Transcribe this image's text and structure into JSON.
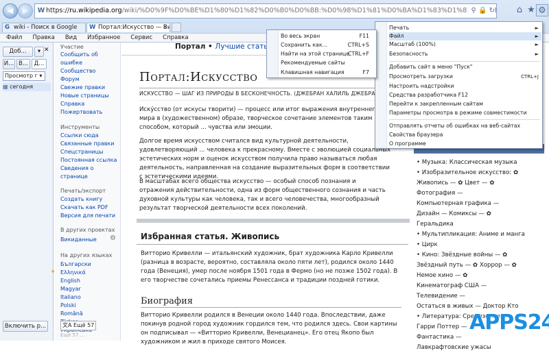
{
  "browser": {
    "address_prefix": "https://",
    "address_host": "ru.wikipedia.org",
    "address_path": "/wiki/%D0%9F%D0%BE%D1%80%D1%82%D0%B0%D0%BB:%D0%98%D1%81%D0%BA%D1%83%D1%81%D1%81%D1%82%D0%B2%D0%BE",
    "tabs": [
      {
        "label": "wiki - Поиск в Google",
        "icon": "G"
      },
      {
        "label": "Портал:Искусство — Вики...",
        "icon": "W"
      }
    ],
    "menu": [
      "Файл",
      "Правка",
      "Вид",
      "Избранное",
      "Сервис",
      "Справка"
    ]
  },
  "left_toolbar": {
    "btn1": "Доб...",
    "btn2": "И...",
    "btn3": "В...",
    "btn4": "Д...",
    "view_select": "Просмотр г",
    "today": "сегодня",
    "enable_button": "Включить р..."
  },
  "sidebar": {
    "participation_title": "Участие",
    "participation": [
      "Сообщить об ошибке",
      "Сообщество",
      "Форум",
      "Свежие правки",
      "Новые страницы",
      "Справка",
      "Пожертвовать"
    ],
    "tools_title": "Инструменты",
    "tools": [
      "Ссылки сюда",
      "Связанные правки",
      "Спецстраницы",
      "Постоянная ссылка",
      "Сведения о странице"
    ],
    "print_title": "Печать/экспорт",
    "print": [
      "Создать книгу",
      "Скачать как PDF",
      "Версия для печати"
    ],
    "projects_title": "В других проектах",
    "projects": [
      "Викиданные"
    ],
    "langs_title": "На других языках",
    "langs": [
      "Български",
      "Ελληνικά",
      "English",
      "Magyar",
      "Italiano",
      "Polski",
      "Română",
      "Türkçe",
      "Українська"
    ],
    "more_langs": "Ещё 57",
    "more_langs_sub": "Ещё 57 ..."
  },
  "page": {
    "breadcrumb_portal": "Портал",
    "breadcrumb_sep": " • ",
    "breadcrumb_link": "Лучшие статьи",
    "title": "Портал:Искусство",
    "motto": "ИСКУССТВО — ШАГ ИЗ ПРИРОДЫ В БЕСКОНЕЧНОСТЬ. (ДЖЕБРАН ХАЛИЛЬ ДЖЕБРАН)",
    "p1": "Иску́сство (от искусы творити) — процесс или итог выражения внутреннего мира в (художественном) образе, творческое сочетание элементов таким способом, который ... чувства или эмоции.",
    "p2": "Долгое время искусством считался вид культурной деятельности, удовлетворяющий ... человека к прекрасному. Вместе с эволюцией социальных эстетических норм и оценок искусством получила право называться любая деятельность, направленная на создание выразительных форм в соответствии с эстетическими идеями.",
    "p3": "В масштабах всего общества искусство — особый способ познания и отражения действительности, одна из форм общественного сознания и часть духовной культуры как человека, так и всего человечества, многообразный результат творческой деятельности всех поколений.",
    "featured_title": "Избранная статья. Живопись",
    "featured_text": "Витторио Кривелли — итальянский художник, брат художника Карло Кривелли (разница в возрасте, вероятно, составляла около пяти лет), родился около 1440 года (Венеция), умер после ноября 1501 года в Фермо (но не позже 1502 года). В его творчестве сочетались приемы Ренессанса и традиции поздней готики.",
    "bio_title": "Биография",
    "bio_text": "Витторио Кривелли родился в Венеции около 1440 года. Впоследствии, даже покинув родной город художник гордился тем, что родился здесь. Свои картины он подписывал — «Витторио Кривелли, Венецианец». Его отец Якопо был художником и жил в приходе святого Моисея."
  },
  "right_list": [
    "• Музыка: Классическая музыка",
    "• Изобразительное искусство: ✿",
    "   Живопись — ✿ Цвет — ✿",
    "   Фотография —",
    "   Компьютерная графика —",
    "   Дизайн — Комиксы — ✿",
    "   Геральдика",
    "• Мультипликация: Аниме и манга",
    "• Цирк",
    "• Кино: Звёздные войны — ✿",
    "   Звёздный путь — ✿ Хоррор — ✿",
    "   Немое кино — ✿",
    "   Кинематограф США —",
    "   Телевидение —",
    "   Остаться в живых — Доктор Кто",
    "• Литература: Средиземье",
    "   Гарри Поттер —",
    "   Фантастика —",
    "   Лавкрафтовские ужасы"
  ],
  "tools_menu": {
    "items": [
      {
        "label": "Печать",
        "arrow": "►"
      },
      {
        "label": "Файл",
        "arrow": "►"
      },
      {
        "label": "Масштаб (100%)",
        "arrow": "►"
      },
      {
        "label": "Безопасность",
        "arrow": "►"
      },
      {
        "label": "Добавить сайт в меню \"Пуск\"",
        "arrow": ""
      },
      {
        "label": "Просмотреть загрузки",
        "arrow": "CTRL+J"
      },
      {
        "label": "Настроить надстройки",
        "arrow": ""
      },
      {
        "label": "Средства разработчика F12",
        "arrow": ""
      },
      {
        "label": "Перейти к закрепленным сайтам",
        "arrow": ""
      },
      {
        "label": "Параметры просмотра в режиме совместимости",
        "arrow": ""
      },
      {
        "label": "Отправлять отчеты об ошибках на веб-сайтах",
        "arrow": ""
      },
      {
        "label": "Свойства браузера",
        "arrow": ""
      },
      {
        "label": "О программе",
        "arrow": ""
      }
    ]
  },
  "file_submenu": {
    "items": [
      {
        "label": "Во весь экран",
        "shortcut": "F11"
      },
      {
        "label": "Сохранить как...",
        "shortcut": "CTRL+S"
      },
      {
        "label": "Найти на этой странице",
        "shortcut": "CTRL+F"
      },
      {
        "label": "Рекомендуемые сайты",
        "shortcut": ""
      },
      {
        "label": "Клавишная навигация",
        "shortcut": "F7"
      }
    ]
  },
  "watermark": "APPS24"
}
